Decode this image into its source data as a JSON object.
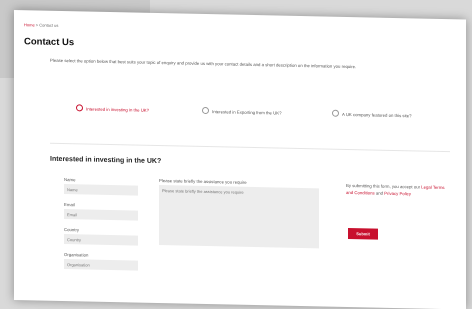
{
  "breadcrumb": {
    "home": "Home",
    "separator": " > ",
    "current": "Contact us"
  },
  "page_title": "Contact Us",
  "intro": "Please select the option below that best suits your topic of enquiry and provide us with your contact details and a short description on the information you require.",
  "options": [
    {
      "label": "Interested in investing in the UK?",
      "selected": true
    },
    {
      "label": "Interested in Exporting from the UK?",
      "selected": false
    },
    {
      "label": "A UK company featured on this site?",
      "selected": false
    }
  ],
  "section_title": "Interested in investing in the UK?",
  "form": {
    "name_label": "Name",
    "name_placeholder": "Name",
    "email_label": "Email",
    "email_placeholder": "Email",
    "country_label": "Country",
    "country_placeholder": "Country",
    "organisation_label": "Organisation",
    "organisation_placeholder": "Organisation",
    "message_label": "Please state briefly the assistance you require",
    "message_placeholder": "Please state briefly the assistance you require"
  },
  "terms": {
    "prefix": "By submitting this form, you accept our ",
    "link1": "Legal Terms and Conditions",
    "middle": " and ",
    "link2": "Privacy Policy"
  },
  "submit_label": "Submit",
  "colors": {
    "accent": "#c8102e",
    "input_bg": "#ededed"
  }
}
